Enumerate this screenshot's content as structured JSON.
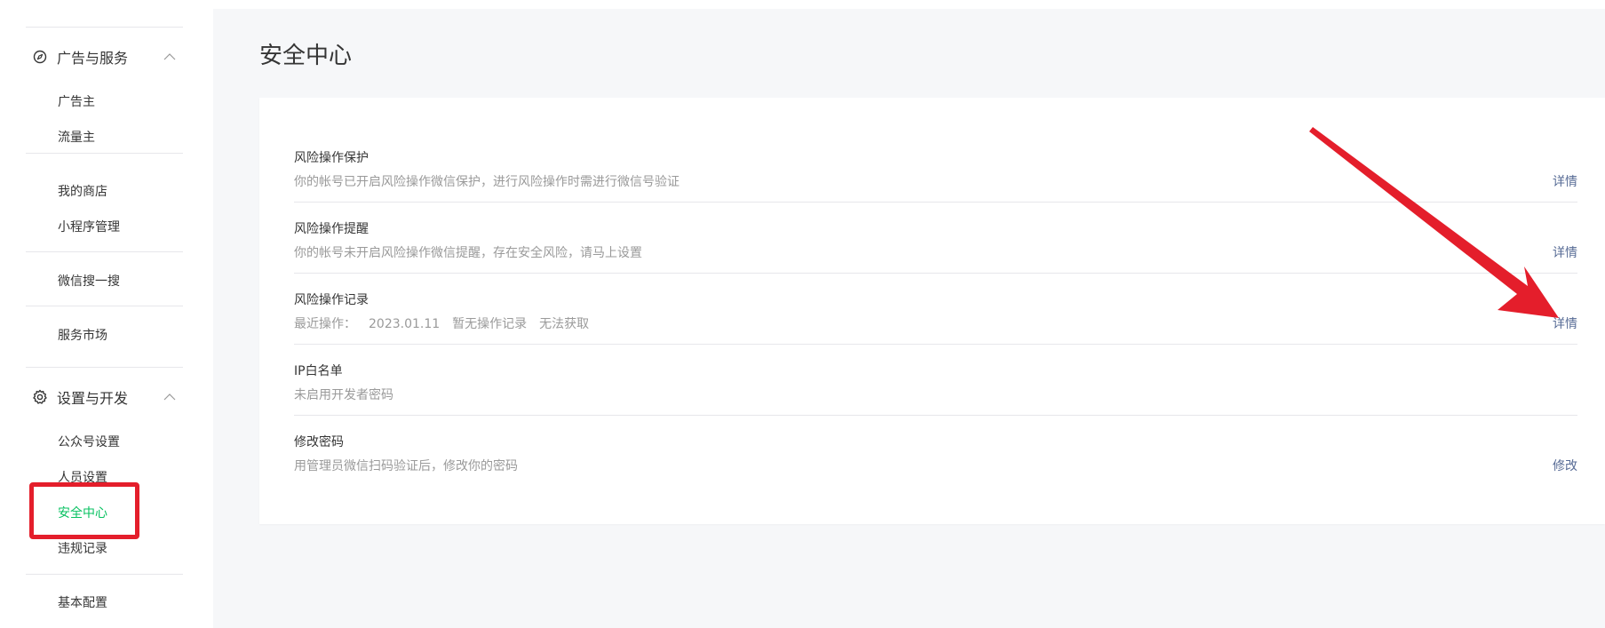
{
  "sidebar": {
    "sections": [
      {
        "label": "广告与服务",
        "icon": "compass-icon",
        "items": [
          "广告主",
          "流量主"
        ]
      },
      {
        "label": "设置与开发",
        "icon": "gear-icon",
        "items": [
          "公众号设置",
          "人员设置",
          "安全中心",
          "违规记录"
        ]
      }
    ],
    "groups": {
      "shop": [
        "我的商店",
        "小程序管理"
      ],
      "search": "微信搜一搜",
      "market": "服务市场",
      "config": "基本配置"
    },
    "active_item": "安全中心"
  },
  "main": {
    "title": "安全中心",
    "rows": [
      {
        "title": "风险操作保护",
        "desc": "你的帐号已开启风险操作微信保护，进行风险操作时需进行微信号验证",
        "action": "详情"
      },
      {
        "title": "风险操作提醒",
        "desc": "你的帐号未开启风险操作微信提醒，存在安全风险，请马上设置",
        "action": "详情"
      },
      {
        "title": "风险操作记录",
        "desc_parts": [
          "最近操作：",
          "2023.01.11",
          "暂无操作记录",
          "无法获取"
        ],
        "action": "详情"
      },
      {
        "title": "IP白名单",
        "desc": "未启用开发者密码",
        "action": ""
      },
      {
        "title": "修改密码",
        "desc": "用管理员微信扫码验证后，修改你的密码",
        "action": "修改"
      }
    ]
  },
  "colors": {
    "active_green": "#07c160",
    "link_blue": "#576b95",
    "annotation_red": "#e41e2b",
    "muted_text": "#9a9a9a",
    "background": "#f6f7f9"
  }
}
